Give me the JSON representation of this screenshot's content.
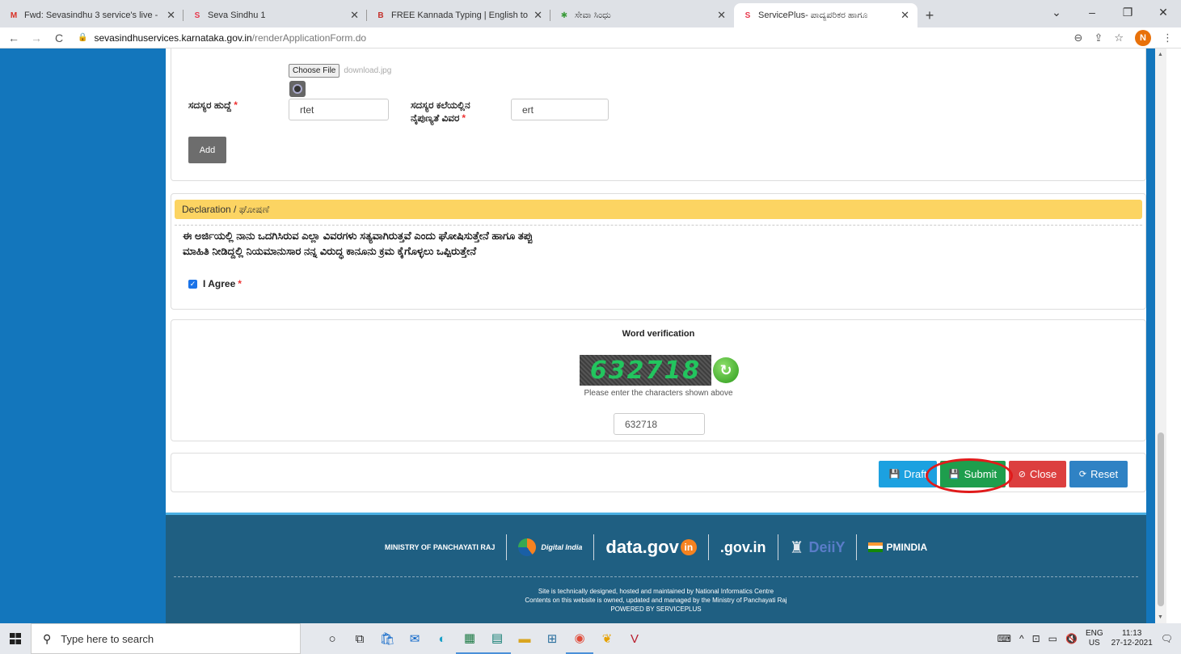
{
  "browser": {
    "tabs": [
      {
        "favicon": "M",
        "favicon_color": "#d93025",
        "title": "Fwd: Sevasindhu 3 service's live -",
        "active": false
      },
      {
        "favicon": "S",
        "favicon_color": "#e8364b",
        "title": "Seva Sindhu 1",
        "active": false
      },
      {
        "favicon": "B",
        "favicon_color": "#c4302b",
        "title": "FREE Kannada Typing | English to",
        "active": false
      },
      {
        "favicon": "✱",
        "favicon_color": "#3a9b3a",
        "title": "ಸೇವಾ ಸಿಂಧು",
        "active": false
      },
      {
        "favicon": "S",
        "favicon_color": "#e8364b",
        "title": "ServicePlus- ಪಾದ್ಯಪರಿಕರ ಹಾಗೂ",
        "active": true
      }
    ],
    "url_host": "sevasindhuservices.karnataka.gov.in",
    "url_path": "/renderApplicationForm.do",
    "profile_initial": "N"
  },
  "form": {
    "file_button": "Choose File",
    "file_name": "download.jpg",
    "member_post_label": "ಸದಸ್ಯರ ಹುದ್ದೆ",
    "member_post_value": "rtet",
    "member_skill_label_line1": "ಸದಸ್ಯರ ಕಲೆಯಲ್ಲಿನ",
    "member_skill_label_line2": "ನೈಪುಣ್ಯತೆ ವಿವರ",
    "member_skill_value": "ert",
    "required_mark": "*",
    "add_label": "Add"
  },
  "declaration": {
    "heading": "Declaration / ಘೋಷಣೆ",
    "text_line1": "ಈ ಅರ್ಜಿಯಲ್ಲಿ ನಾನು ಒದಗಿಸಿರುವ ಎಲ್ಲಾ ವಿವರಗಳು ಸತ್ಯವಾಗಿರುತ್ತವೆ ಎಂದು ಘೋಷಿಸುತ್ತೇನೆ ಹಾಗೂ ತಪ್ಪು",
    "text_line2": "ಮಾಹಿತಿ ನೀಡಿದ್ದಲ್ಲಿ ನಿಯಮಾನುಸಾರ ನನ್ನ ವಿರುದ್ಧ ಕಾನೂನು ಕ್ರಮ ಕೈಗೊಳ್ಳಲು ಒಪ್ಪಿರುತ್ತೇನೆ",
    "agree_label": "I Agree",
    "agree_checked": true
  },
  "captcha": {
    "title": "Word verification",
    "image_text": "632718",
    "hint": "Please enter the characters shown above",
    "input_value": "632718"
  },
  "actions": {
    "draft": "Draft",
    "submit": "Submit",
    "close": "Close",
    "reset": "Reset"
  },
  "footer": {
    "logo_mopr": "MINISTRY OF PANCHAYATI RAJ",
    "logo_digital_india": "Digital India",
    "logo_datagov": "data.gov",
    "logo_datagov_suffix": "in",
    "logo_indiagov": ".gov.in",
    "logo_digy": "DeiiY",
    "logo_pmindia": "PMINDIA",
    "line1": "Site is technically designed, hosted and maintained by National Informatics Centre",
    "line2": "Contents on this website is owned, updated and managed by the Ministry of Panchayati Raj",
    "line3": "POWERED BY SERVICEPLUS"
  },
  "taskbar": {
    "search_placeholder": "Type here to search",
    "lang_top": "ENG",
    "lang_bottom": "US",
    "time": "11:13",
    "date": "27-12-2021"
  },
  "colors": {
    "side_blue": "#1376bc",
    "declaration_yellow": "#fcd462",
    "submit_green": "#1e9e4d",
    "close_red": "#dc3f3f",
    "draft_blue": "#1ca1e0",
    "footer_blue": "#1f5f82",
    "highlight_red": "#e01b1b"
  }
}
